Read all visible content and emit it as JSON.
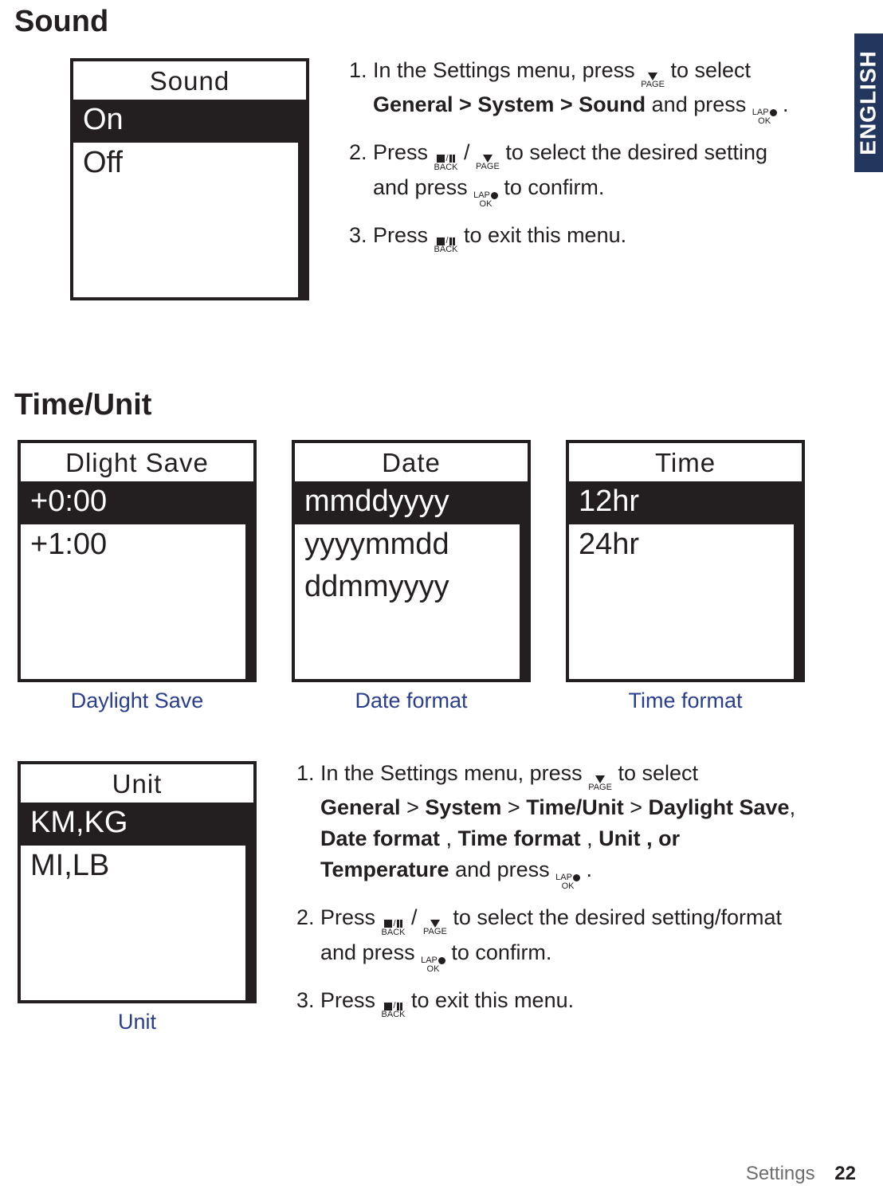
{
  "lang_tab": "ENGLISH",
  "section_sound": {
    "title": "Sound",
    "device": {
      "title": "Sound",
      "options": [
        "On",
        "Off"
      ],
      "selected": 0
    },
    "instructions": {
      "s1a": "In the Settings menu, press ",
      "s1b": " to select ",
      "s1c": "General > System > Sound",
      "s1d": " and press ",
      "s1e": " .",
      "s2a": "Press ",
      "s2b": " / ",
      "s2c": " to select the desired setting and press ",
      "s2d": " to confirm.",
      "s3a": "Press ",
      "s3b": " to exit this menu."
    }
  },
  "section_timeunit": {
    "title": "Time/Unit",
    "devices": {
      "dlight": {
        "title": "Dlight Save",
        "options": [
          "+0:00",
          "+1:00"
        ],
        "selected": 0,
        "caption": "Daylight Save"
      },
      "date": {
        "title": "Date",
        "options": [
          "mmddyyyy",
          "yyyymmdd",
          "ddmmyyyy"
        ],
        "selected": 0,
        "caption": "Date format"
      },
      "time": {
        "title": "Time",
        "options": [
          "12hr",
          "24hr"
        ],
        "selected": 0,
        "caption": "Time format"
      },
      "unit": {
        "title": "Unit",
        "options": [
          "KM,KG",
          "MI,LB"
        ],
        "selected": 0,
        "caption": "Unit"
      }
    },
    "instructions": {
      "s1a": "In the Settings menu, press ",
      "s1b": " to select",
      "s1c_parts": {
        "p1": "General",
        "gt": " > ",
        "p2": "System",
        "p3": "Time/Unit",
        "p4": "Daylight Save",
        "c": ", ",
        "p5": "Date format",
        "c2": " , ",
        "p6": "Time format",
        "c3": " , ",
        "p7": "Unit",
        "c4": " , or ",
        "p8": "Temperature",
        "and": " and "
      },
      "s1d_press": "press ",
      "s1e": ".",
      "s2a": "Press ",
      "s2b": " / ",
      "s2c": " to select the desired setting/format and press ",
      "s2d": " to confirm.",
      "s3a": "Press ",
      "s3b": " to exit this menu."
    }
  },
  "buttons": {
    "page_lbl": "PAGE",
    "back_lbl": "BACK",
    "lap_lbl": "LAP",
    "ok_lbl": "OK"
  },
  "footer": {
    "section": "Settings",
    "page": "22"
  }
}
